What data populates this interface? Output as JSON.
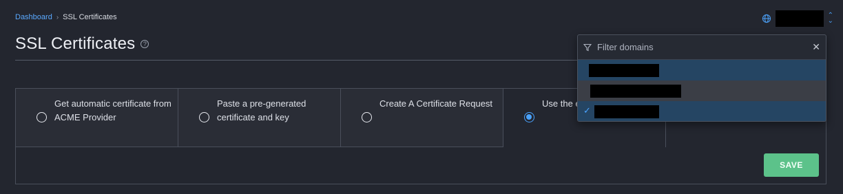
{
  "breadcrumb": {
    "home": "Dashboard",
    "separator": "›",
    "current": "SSL Certificates"
  },
  "page": {
    "title": "SSL Certificates",
    "help_icon": "question-circle-icon"
  },
  "domain_selector": {
    "icon": "globe-icon",
    "value": "",
    "caret": "updown-chevron-icon"
  },
  "dropdown": {
    "filter_placeholder": "Filter domains",
    "items": [
      {
        "label": "",
        "selected": false
      },
      {
        "label": "",
        "selected": false
      },
      {
        "label": "",
        "selected": true
      }
    ]
  },
  "options": [
    {
      "label": "Get automatic certificate from ACME Provider",
      "selected": false
    },
    {
      "label": "Paste a pre-generated certificate and key",
      "selected": false
    },
    {
      "label": "Create A Certificate Request",
      "selected": false
    },
    {
      "label": "Use the existing certificate",
      "selected": true
    }
  ],
  "actions": {
    "save_label": "SAVE"
  },
  "colors": {
    "accent": "#4aa3ff",
    "save": "#5cc28a",
    "background": "#23262f"
  }
}
